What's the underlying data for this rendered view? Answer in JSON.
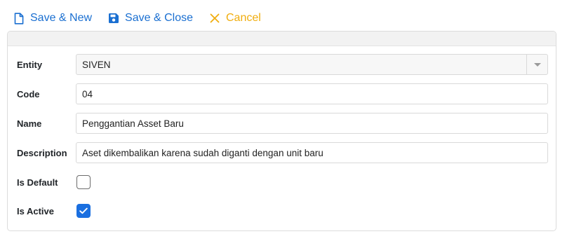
{
  "toolbar": {
    "save_new_label": "Save & New",
    "save_close_label": "Save & Close",
    "cancel_label": "Cancel"
  },
  "form": {
    "entity": {
      "label": "Entity",
      "value": "SIVEN"
    },
    "code": {
      "label": "Code",
      "value": "04"
    },
    "name": {
      "label": "Name",
      "value": "Penggantian Asset Baru"
    },
    "description": {
      "label": "Description",
      "value": "Aset dikembalikan karena sudah diganti dengan unit baru"
    },
    "is_default": {
      "label": "Is Default",
      "checked": false
    },
    "is_active": {
      "label": "Is Active",
      "checked": true
    }
  },
  "colors": {
    "primary": "#1a6fd1",
    "cancel": "#f0ad0e",
    "checkbox_checked": "#1a6fe0"
  }
}
